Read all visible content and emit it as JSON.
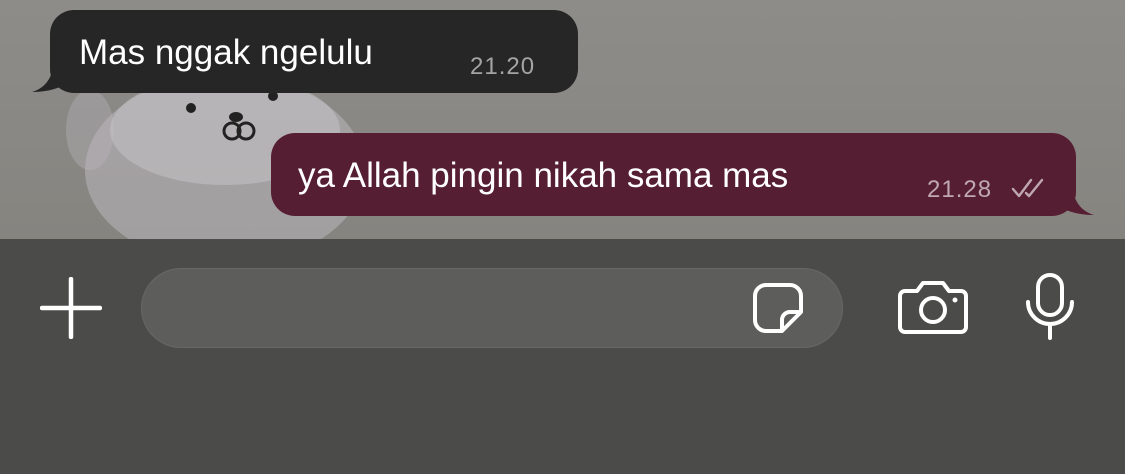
{
  "conversation": {
    "messages": [
      {
        "direction": "incoming",
        "text": "Mas nggak ngelulu",
        "time": "21.20"
      },
      {
        "direction": "outgoing",
        "text": "ya Allah pingin nikah sama mas",
        "time": "21.28",
        "status_icon": "double-check-icon"
      }
    ]
  },
  "composer": {
    "input_value": "",
    "input_placeholder": "",
    "icons": [
      "plus-icon",
      "sticker-icon",
      "camera-icon",
      "microphone-icon"
    ]
  },
  "colors": {
    "incoming_bubble": "#262626",
    "outgoing_bubble": "#561e33",
    "composer_background": "#4b4b49"
  }
}
